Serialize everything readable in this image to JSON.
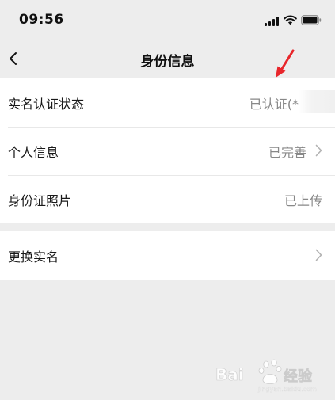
{
  "status_bar": {
    "time": "09:56"
  },
  "nav": {
    "title": "身份信息",
    "back_icon": "chevron-left-icon"
  },
  "groups": [
    {
      "items": [
        {
          "label": "实名认证状态",
          "value": "已认证(*",
          "has_chevron": false
        },
        {
          "label": "个人信息",
          "value": "已完善",
          "has_chevron": true
        },
        {
          "label": "身份证照片",
          "value": "已上传",
          "has_chevron": false
        }
      ]
    },
    {
      "items": [
        {
          "label": "更换实名",
          "value": "",
          "has_chevron": true
        }
      ]
    }
  ],
  "colors": {
    "background": "#ededed",
    "cell_bg": "#ffffff",
    "annotation_arrow": "#e8262b",
    "secondary_text": "#888888"
  },
  "watermark": {
    "icon": "baidu-paw-logo",
    "text": "Bai经验"
  }
}
